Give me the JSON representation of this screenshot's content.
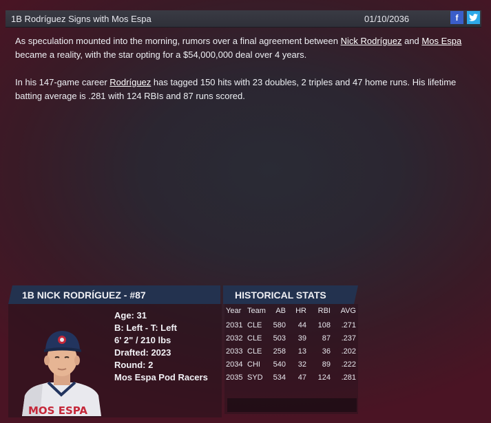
{
  "header": {
    "title": "1B Rodríguez Signs with Mos Espa",
    "date": "01/10/2036",
    "facebook_icon": "f",
    "twitter_icon": "🐦"
  },
  "article": {
    "p1_pre": "As speculation mounted into the morning, rumors over a final agreement between ",
    "p1_link1": "Nick Rodríguez",
    "p1_mid": " and ",
    "p1_link2": "Mos Espa",
    "p1_post": " became a reality, with the star opting for a $54,000,000 deal over 4 years.",
    "p2_pre": "In his 147-game career ",
    "p2_link": "Rodríguez",
    "p2_post": " has tagged 150 hits with 23 doubles, 2 triples and 47 home runs. His lifetime batting average is .281 with 124 RBIs and 87 runs scored."
  },
  "player": {
    "header": "1B NICK RODRÍGUEZ - #87",
    "age": "Age: 31",
    "bats_throws": "B: Left - T: Left",
    "size": "6' 2\" / 210 lbs",
    "drafted": "Drafted: 2023",
    "round": "Round: 2",
    "team": "Mos Espa Pod Racers",
    "jersey_text": "MOS ESPA"
  },
  "stats": {
    "header": "HISTORICAL STATS",
    "columns": [
      "Year",
      "Team",
      "AB",
      "HR",
      "RBI",
      "AVG"
    ],
    "rows": [
      [
        "2031",
        "CLE",
        "580",
        "44",
        "108",
        ".271"
      ],
      [
        "2032",
        "CLE",
        "503",
        "39",
        "87",
        ".237"
      ],
      [
        "2033",
        "CLE",
        "258",
        "13",
        "36",
        ".202"
      ],
      [
        "2034",
        "CHI",
        "540",
        "32",
        "89",
        ".222"
      ],
      [
        "2035",
        "SYD",
        "534",
        "47",
        "124",
        ".281"
      ]
    ]
  }
}
